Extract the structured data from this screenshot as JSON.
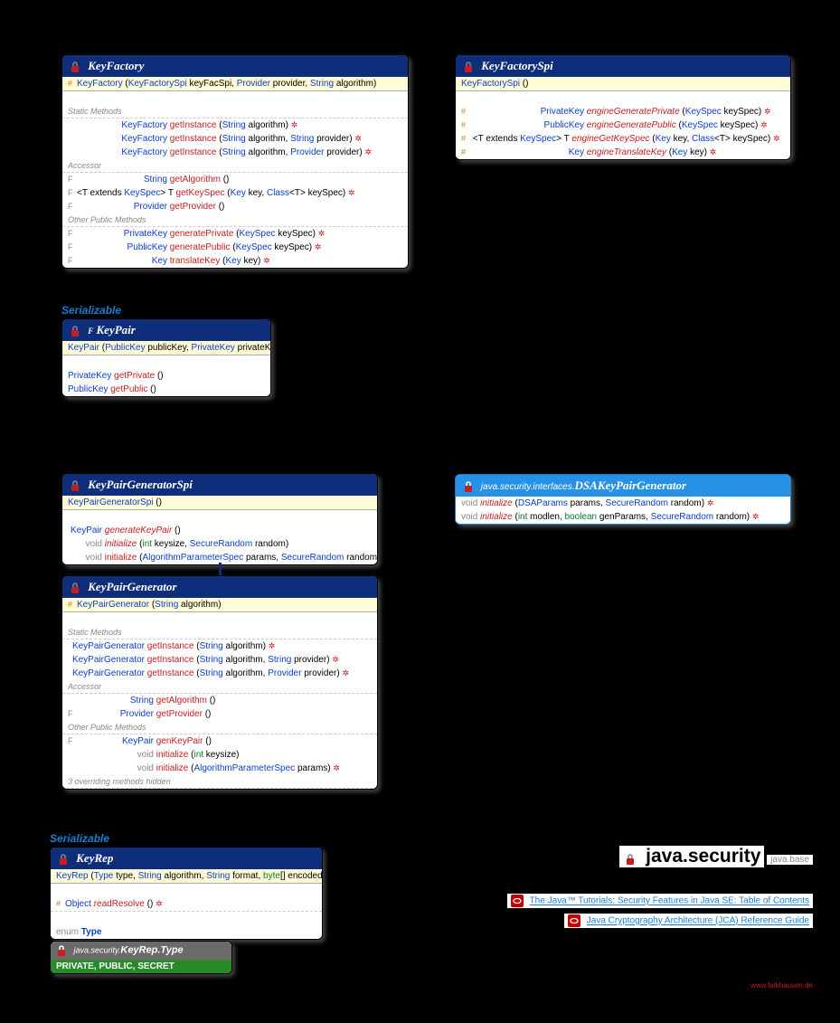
{
  "keyFactory": {
    "name": "KeyFactory",
    "ctor": "KeyFactory (KeyFactorySpi keyFacSpi, Provider provider, String algorithm)",
    "staticLabel": "Static Methods",
    "s1": "KeyFactory  getInstance (String algorithm)",
    "s2": "KeyFactory  getInstance (String algorithm, String provider)",
    "s3": "KeyFactory  getInstance (String algorithm, Provider provider)",
    "accLabel": "Accessor",
    "a1": "String  getAlgorithm ()",
    "a2": "<T extends KeySpec> T  getKeySpec (Key key, Class<T> keySpec)",
    "a3": "Provider  getProvider ()",
    "otherLabel": "Other Public Methods",
    "o1": "PrivateKey  generatePrivate (KeySpec keySpec)",
    "o2": "PublicKey  generatePublic (KeySpec keySpec)",
    "o3": "Key  translateKey (Key key)"
  },
  "keyFactorySpi": {
    "name": "KeyFactorySpi",
    "ctor": "KeyFactorySpi ()",
    "m1": "PrivateKey  engineGeneratePrivate (KeySpec keySpec)",
    "m2": "PublicKey  engineGeneratePublic (KeySpec keySpec)",
    "m3": "<T extends KeySpec> T  engineGetKeySpec (Key key, Class<T> keySpec)",
    "m4": "Key  engineTranslateKey (Key key)"
  },
  "keyPair": {
    "name": "KeyPair",
    "ser": "Serializable",
    "ctor": "KeyPair (PublicKey publicKey, PrivateKey privateKey)",
    "m1": "PrivateKey  getPrivate ()",
    "m2": "PublicKey  getPublic ()"
  },
  "kpgSpi": {
    "name": "KeyPairGeneratorSpi",
    "ctor": "KeyPairGeneratorSpi ()",
    "m1": "KeyPair  generateKeyPair ()",
    "m2": "void  initialize (int keysize, SecureRandom random)",
    "m3": "void  initialize (AlgorithmParameterSpec params, SecureRandom random)"
  },
  "dsa": {
    "pkg": "java.security.interfaces.",
    "name": "DSAKeyPairGenerator",
    "m1": "void  initialize (DSAParams params, SecureRandom random)",
    "m2": "void  initialize (int modlen, boolean genParams, SecureRandom random)"
  },
  "kpg": {
    "name": "KeyPairGenerator",
    "ctor": "KeyPairGenerator (String algorithm)",
    "staticLabel": "Static Methods",
    "s1": "KeyPairGenerator  getInstance (String algorithm)",
    "s2": "KeyPairGenerator  getInstance (String algorithm, String provider)",
    "s3": "KeyPairGenerator  getInstance (String algorithm, Provider provider)",
    "accLabel": "Accessor",
    "a1": "String  getAlgorithm ()",
    "a2": "Provider  getProvider ()",
    "otherLabel": "Other Public Methods",
    "o1": "KeyPair  genKeyPair ()",
    "o2": "void  initialize (int keysize)",
    "o3": "void  initialize (AlgorithmParameterSpec params)",
    "hidden": "3 overriding methods hidden"
  },
  "keyRep": {
    "name": "KeyRep",
    "ser": "Serializable",
    "ctor": "KeyRep (Type type, String algorithm, String format, byte[] encoded)",
    "m1": "Object  readResolve ()",
    "enum": "enum Type"
  },
  "keyRepType": {
    "pkg": "java.security.",
    "name": "KeyRep.Type",
    "vals": "PRIVATE, PUBLIC, SECRET"
  },
  "pkgTitle": "java.security",
  "pkgMod": "java.base",
  "link1": "The Java™ Tutorials: Security Features in Java SE: Table of Contents",
  "link2": "Java Cryptography Architecture (JCA) Reference Guide",
  "credit": "www.falkhausen.de"
}
